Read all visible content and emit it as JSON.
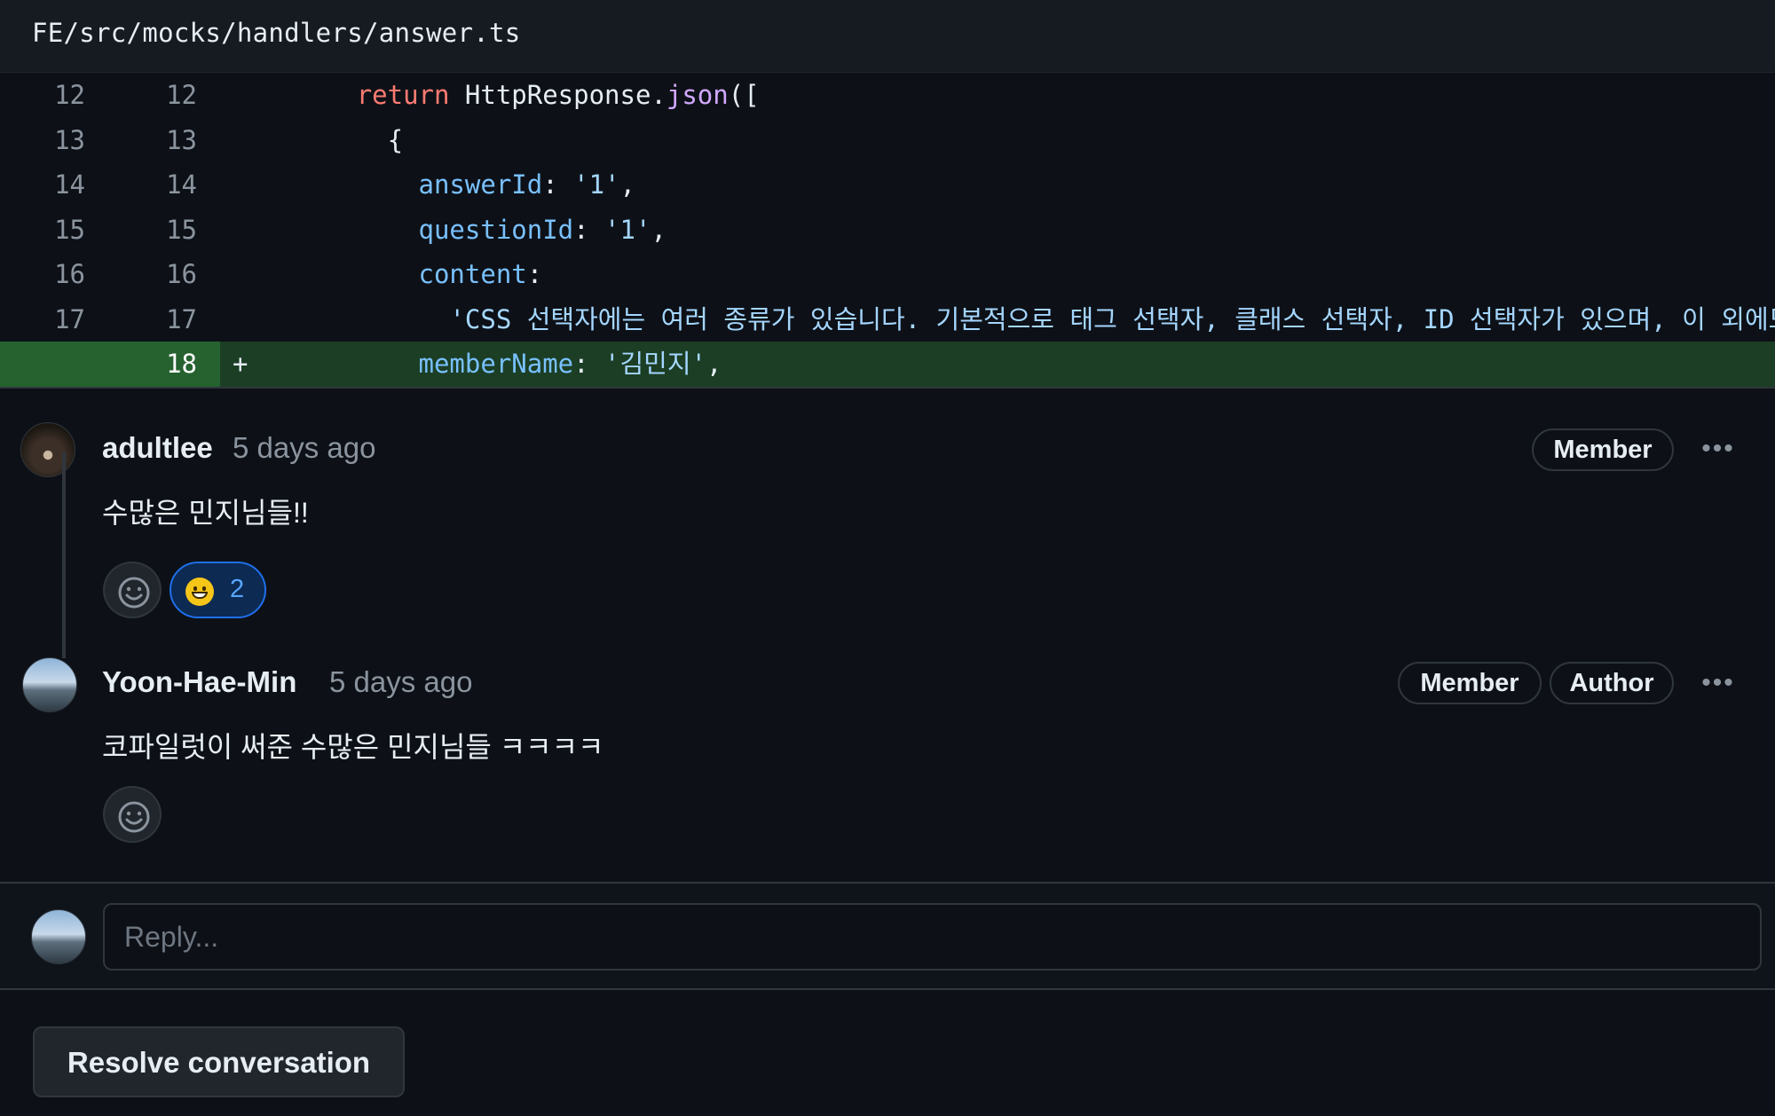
{
  "file": {
    "path": "FE/src/mocks/handlers/answer.ts"
  },
  "diff": {
    "lines": [
      {
        "old": "12",
        "new": "12",
        "marker": "",
        "tokens": [
          [
            "plain",
            "        "
          ],
          [
            "kw",
            "return"
          ],
          [
            "plain",
            " HttpResponse."
          ],
          [
            "fn",
            "json"
          ],
          [
            "plain",
            "(["
          ]
        ]
      },
      {
        "old": "13",
        "new": "13",
        "marker": "",
        "tokens": [
          [
            "plain",
            "          {"
          ]
        ]
      },
      {
        "old": "14",
        "new": "14",
        "marker": "",
        "tokens": [
          [
            "plain",
            "            "
          ],
          [
            "prop",
            "answerId"
          ],
          [
            "plain",
            ": "
          ],
          [
            "str",
            "'1'"
          ],
          [
            "plain",
            ","
          ]
        ]
      },
      {
        "old": "15",
        "new": "15",
        "marker": "",
        "tokens": [
          [
            "plain",
            "            "
          ],
          [
            "prop",
            "questionId"
          ],
          [
            "plain",
            ": "
          ],
          [
            "str",
            "'1'"
          ],
          [
            "plain",
            ","
          ]
        ]
      },
      {
        "old": "16",
        "new": "16",
        "marker": "",
        "tokens": [
          [
            "plain",
            "            "
          ],
          [
            "prop",
            "content"
          ],
          [
            "plain",
            ":"
          ]
        ]
      },
      {
        "old": "17",
        "new": "17",
        "marker": "",
        "tokens": [
          [
            "plain",
            "              "
          ],
          [
            "str",
            "'CSS 선택자에는 여러 종류가 있습니다. 기본적으로 태그 선택자, 클래스 선택자, ID 선택자가 있으며, 이 외에도"
          ]
        ]
      },
      {
        "old": "",
        "new": "18",
        "marker": "+",
        "tokens": [
          [
            "plain",
            "            "
          ],
          [
            "prop",
            "memberName"
          ],
          [
            "plain",
            ": "
          ],
          [
            "str",
            "'김민지'"
          ],
          [
            "plain",
            ","
          ]
        ]
      }
    ]
  },
  "comments": [
    {
      "author": "adultlee",
      "time": "5 days ago",
      "badges": [
        "Member"
      ],
      "body": "수많은 민지님들!!",
      "reaction": {
        "emoji": "grinning-face",
        "count": "2"
      }
    },
    {
      "author": "Yoon-Hae-Min",
      "time": "5 days ago",
      "badges": [
        "Member",
        "Author"
      ],
      "body": "코파일럿이 써준 수많은 민지님들 ㅋㅋㅋㅋ"
    }
  ],
  "reply": {
    "placeholder": "Reply..."
  },
  "actions": {
    "resolve_label": "Resolve conversation"
  },
  "colors": {
    "background": "#0d1117",
    "added_line": "#1b3e24",
    "added_gutter": "#25622f",
    "reaction_accent": "#1f6feb"
  },
  "icons": {
    "more": "kebab-horizontal-icon",
    "add_reaction": "smiley-icon"
  }
}
